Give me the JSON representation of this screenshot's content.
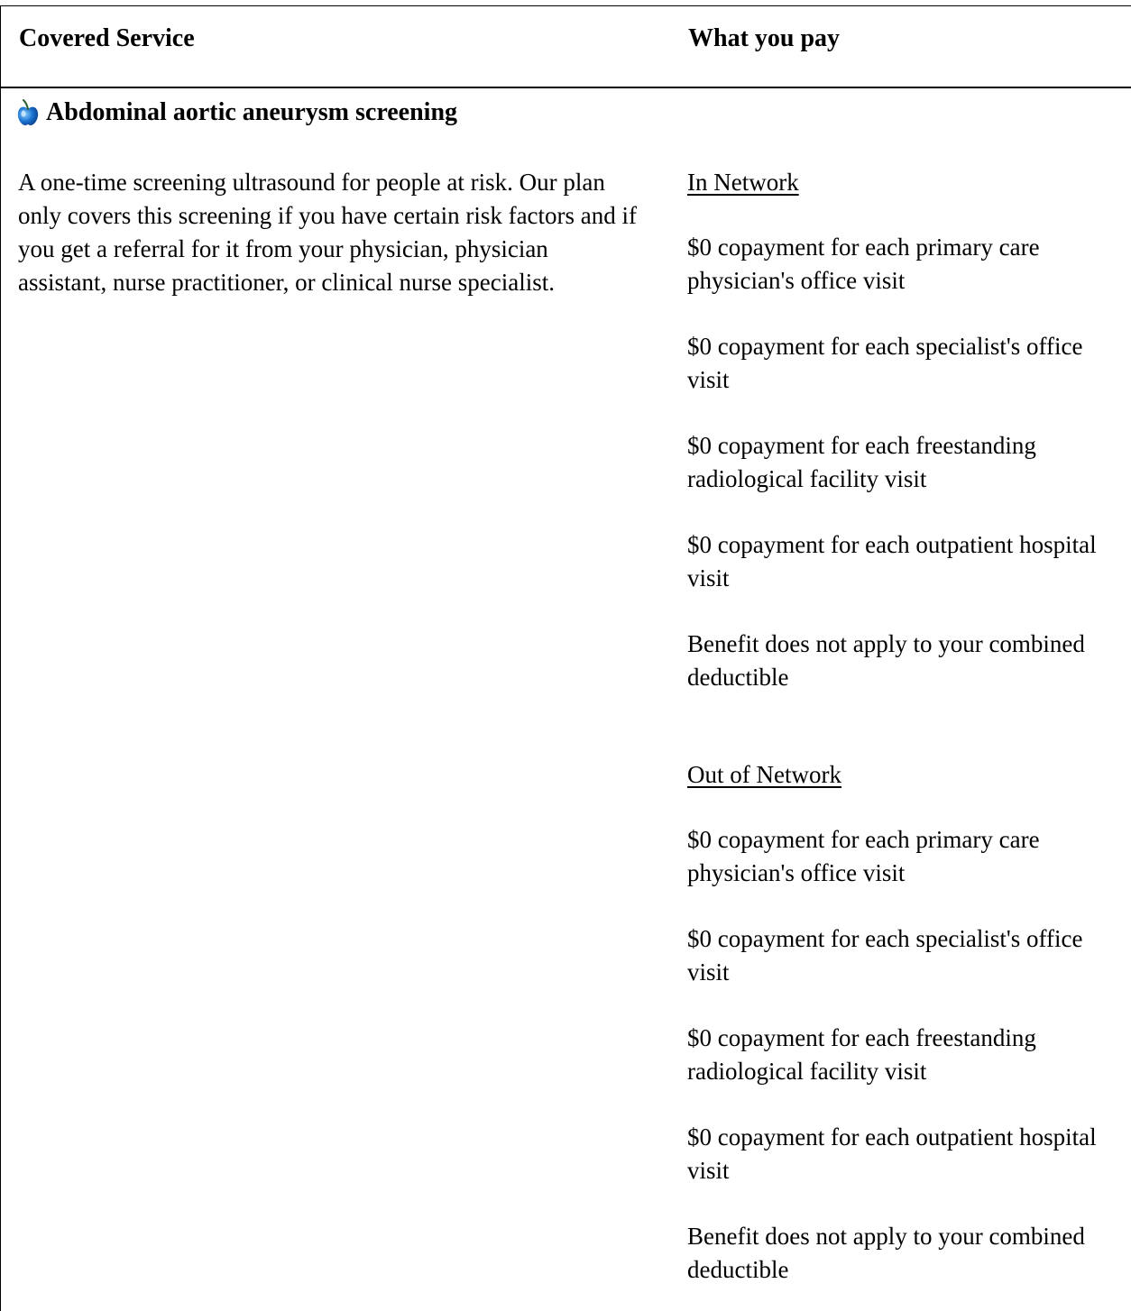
{
  "table": {
    "header_left": "Covered Service",
    "header_right": "What you pay"
  },
  "service": {
    "icon": "apple-icon",
    "title": "Abdominal aortic aneurysm screening",
    "description": "A one-time screening ultrasound for people at risk. Our plan only covers this screening if you have certain risk factors and if you get a referral for it from your physician, physician assistant, nurse practitioner, or clinical nurse specialist."
  },
  "in_network": {
    "label": "In Network",
    "items": [
      "$0 copayment for each primary care physician's office visit",
      "$0 copayment for each specialist's office visit",
      "$0 copayment for each freestanding radiological facility visit",
      "$0 copayment for each outpatient hospital visit",
      "Benefit does not apply to your combined deductible"
    ]
  },
  "out_network": {
    "label": "Out of Network",
    "items": [
      "$0 copayment for each primary care physician's office visit",
      "$0 copayment for each specialist's office visit",
      "$0 copayment for each freestanding radiological facility visit",
      "$0 copayment for each outpatient hospital visit",
      "Benefit does not apply to your combined deductible"
    ]
  },
  "colors": {
    "apple": "#1a73d1",
    "apple_highlight": "#8fd0ff",
    "stem": "#2a5e2a"
  }
}
